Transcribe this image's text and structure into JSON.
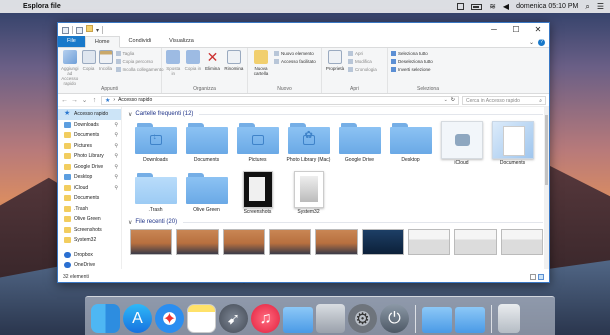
{
  "menubar": {
    "app_name": "Esplora file",
    "clock": "domenica 05:10 PM",
    "icons": [
      "apple-icon",
      "window-icon",
      "battery-icon",
      "wifi-icon",
      "volume-icon",
      "search-icon",
      "menu-icon"
    ]
  },
  "window": {
    "title": "",
    "quick_access_dropdown": "▾",
    "controls": {
      "minimize": "─",
      "maximize": "☐",
      "close": "✕"
    }
  },
  "tabs": {
    "file": "File",
    "home": "Home",
    "share": "Condividi",
    "view": "Visualizza",
    "help": "?"
  },
  "ribbon": {
    "clipboard": {
      "label": "Appunti",
      "pin": "Aggiungi ad Accesso rapido",
      "copy": "Copia",
      "paste": "Incolla",
      "cut": "Taglia",
      "copy_path": "Copia percorso",
      "paste_shortcut": "Incolla collegamento"
    },
    "organize": {
      "label": "Organizza",
      "move_to": "Sposta in",
      "copy_to": "Copia in",
      "delete": "Elimina",
      "rename": "Rinomina"
    },
    "new": {
      "label": "Nuovo",
      "new_folder": "Nuova cartella",
      "new_item": "Nuovo elemento",
      "easy_access": "Accesso facilitato"
    },
    "open": {
      "label": "Apri",
      "properties": "Proprietà",
      "open": "Apri",
      "edit": "Modifica",
      "history": "Cronologia"
    },
    "select": {
      "label": "Seleziona",
      "select_all": "Seleziona tutto",
      "select_none": "Deseleziona tutto",
      "invert": "Inverti selezione"
    }
  },
  "address": {
    "path": "Accesso rapido",
    "search_placeholder": "Cerca in Accesso rapido"
  },
  "sidebar": {
    "items": [
      {
        "label": "Accesso rapido",
        "icon": "star-icon",
        "active": true,
        "pinned": false
      },
      {
        "label": "Downloads",
        "icon": "downloads-folder-icon",
        "pinned": true
      },
      {
        "label": "Documents",
        "icon": "folder-icon",
        "pinned": true
      },
      {
        "label": "Pictures",
        "icon": "folder-icon",
        "pinned": true
      },
      {
        "label": "Photo Library",
        "icon": "folder-icon",
        "pinned": true
      },
      {
        "label": "Google Drive",
        "icon": "folder-icon",
        "pinned": true
      },
      {
        "label": "Desktop",
        "icon": "desktop-folder-icon",
        "pinned": true
      },
      {
        "label": "iCloud",
        "icon": "folder-icon",
        "pinned": true
      },
      {
        "label": "Documents",
        "icon": "folder-icon",
        "pinned": false
      },
      {
        "label": ".Trash",
        "icon": "folder-icon",
        "pinned": false
      },
      {
        "label": "Olive Green",
        "icon": "folder-icon",
        "pinned": false
      },
      {
        "label": "Screenshots",
        "icon": "folder-icon",
        "pinned": false
      },
      {
        "label": "System32",
        "icon": "folder-icon",
        "pinned": false
      },
      {
        "label": "Dropbox",
        "icon": "dropbox-icon",
        "pinned": false
      },
      {
        "label": "OneDrive",
        "icon": "onedrive-icon",
        "pinned": false
      }
    ]
  },
  "frequent": {
    "heading": "Cartelle frequenti (12)",
    "items": [
      {
        "label": "Downloads",
        "kind": "folder-download"
      },
      {
        "label": "Documents",
        "kind": "folder"
      },
      {
        "label": "Pictures",
        "kind": "folder-camera"
      },
      {
        "label": "Photo Library (Mac)",
        "kind": "folder-flower"
      },
      {
        "label": "Google Drive",
        "kind": "folder"
      },
      {
        "label": "Desktop",
        "kind": "folder"
      },
      {
        "label": "iCloud",
        "kind": "icloud"
      },
      {
        "label": "Documents",
        "kind": "docs"
      },
      {
        "label": ".Trash",
        "kind": "folder-light"
      },
      {
        "label": "Olive Green",
        "kind": "folder"
      },
      {
        "label": "Screenshots",
        "kind": "dark-doc"
      },
      {
        "label": "System32",
        "kind": "light-doc"
      }
    ]
  },
  "recent": {
    "heading": "File recenti (20)",
    "thumbs": [
      "desktop-photo",
      "desktop-photo",
      "desktop-photo",
      "desktop-photo",
      "desktop-photo",
      "dark-screen",
      "window",
      "window",
      "window"
    ]
  },
  "status": {
    "count": "32 elementi"
  },
  "dock": {
    "apps": [
      "finder-icon",
      "app-store-icon",
      "safari-icon",
      "notes-icon",
      "launchpad-icon",
      "itunes-icon",
      "folder-icon",
      "generic-app-icon",
      "system-preferences-icon",
      "power-icon",
      "folder-icon",
      "folder-icon",
      "trash-icon"
    ]
  }
}
